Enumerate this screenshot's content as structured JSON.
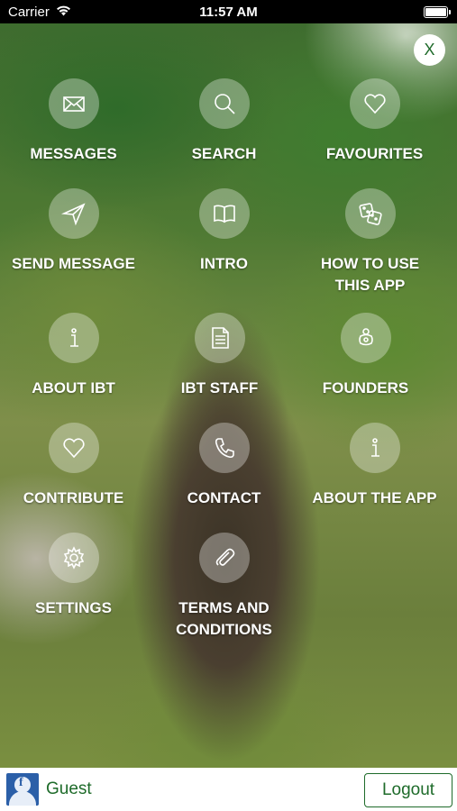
{
  "status_bar": {
    "carrier": "Carrier",
    "time": "11:57 AM"
  },
  "close_label": "X",
  "menu": {
    "messages": "MESSAGES",
    "search": "SEARCH",
    "favourites": "FAVOURITES",
    "send_message": "SEND MESSAGE",
    "intro": "INTRO",
    "how_to_use": "HOW TO USE\nTHIS APP",
    "about_ibt": "ABOUT IBT",
    "ibt_staff": "IBT STAFF",
    "founders": "FOUNDERS",
    "contribute": "CONTRIBUTE",
    "contact": "CONTACT",
    "about_app": "ABOUT THE APP",
    "settings": "SETTINGS",
    "terms": "TERMS AND\nCONDITIONS"
  },
  "icons": [
    "envelope-icon",
    "search-icon",
    "heart-icon",
    "paper-plane-icon",
    "book-icon",
    "dice-icon",
    "info-icon",
    "document-icon",
    "pacifier-icon",
    "heart-icon",
    "phone-icon",
    "info-icon",
    "gear-icon",
    "paperclip-icon"
  ],
  "footer": {
    "user_name": "Guest",
    "logout_label": "Logout",
    "accent_color": "#1e6b2a"
  }
}
